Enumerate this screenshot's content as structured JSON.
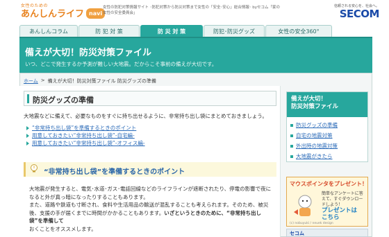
{
  "header": {
    "logo_small": "女性のための",
    "logo_main": "あんしんライフ",
    "logo_badge": "navi",
    "tagline": "女性の防犯対策情報サイト ･防犯対策から防災対策まで女性の「安全･安心」総合情報･ byセコム「家の女性の安全委員会」",
    "secom_tag": "信頼される安心を、社会へ。",
    "secom_logo": "SECOM"
  },
  "nav": {
    "tabs": [
      {
        "label": "あんしんコラム",
        "active": false
      },
      {
        "label": "防 犯 対 策",
        "active": false
      },
      {
        "label": "防 災 対 策",
        "active": true
      },
      {
        "label": "防犯･防災グッズ",
        "active": false
      },
      {
        "label": "女性の安全360°",
        "active": false
      }
    ]
  },
  "banner": {
    "title": "備えが大切！防災対策ファイル",
    "subtitle": "いつ、どこで発生するか予測が難しい大地震。だからこそ事前の備えが大切です。"
  },
  "breadcrumb": {
    "home": "ホーム",
    "separator": ">",
    "current": "備えが大切！防災対策ファイル 防災グッズの準備"
  },
  "section": {
    "title": "防災グッズの準備",
    "intro": "大地震などに備えて、必要なものをすぐに持ち出せるように、非常持ち出し袋にまとめておきましょう。"
  },
  "links": [
    "“非常持ち出し袋”を準備するときのポイント",
    "用意しておきたい“非常持ち出し袋”-自宅編-",
    "用意しておきたい“非常持ち出し袋”-オフィス編-"
  ],
  "tip": {
    "title": "“非常持ち出し袋”を準備するときのポイント"
  },
  "body": {
    "line1": "大地震が発生すると、電気･水道･ガス･電話回線などのライフラインが遮断されたり、停電の影響で夜になると外が真っ暗になったりすることもあります。",
    "line2": "また、道路や鉄道も寸断され、食料や生活用品の輸送が混乱することも考えられます。そのため、被災後、支援の手が届くまでに時間がかかることもあります。",
    "emphasis": "いざというときのために、“非常持ち出し袋”を準備して",
    "line3": "おくことをオススメします。"
  },
  "sidebar": {
    "head_line1": "備えが大切！",
    "head_line2": "防災対策ファイル",
    "items": [
      "防災グッズの準備",
      "自宅の地震対策",
      "外出時の地震対策",
      "大地震がきたら"
    ]
  },
  "promo": {
    "title": "マウスポインタをプレゼント！",
    "text": "簡単なアンケートに答えて、すぐダウンロードしよう！",
    "cta_line1": "プレゼントは",
    "cta_line2": "こちら",
    "credit": "(c) nobuyuki / neuek design"
  },
  "secom_side": {
    "label": "セコム"
  },
  "colors": {
    "accent": "#27a79d",
    "link": "#2a6ab8",
    "brand": "#1a4aa8",
    "logo": "#e8821e"
  }
}
